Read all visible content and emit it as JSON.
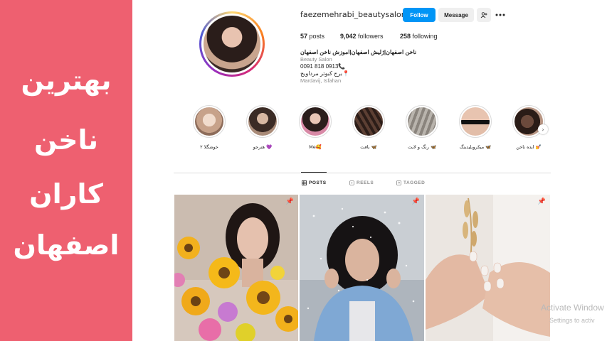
{
  "banner": {
    "lines": [
      "بهترین",
      "ناخن",
      "کاران",
      "اصفهان"
    ],
    "color": "#ee6070"
  },
  "profile": {
    "username": "faezemehrabi_beautysalon",
    "follow_label": "Follow",
    "message_label": "Message",
    "add_user_icon": "add-user-icon",
    "more_icon": "more-icon",
    "stats": {
      "posts_count": "57",
      "posts_label": "posts",
      "followers_count": "9,042",
      "followers_label": "followers",
      "following_count": "258",
      "following_label": "following"
    },
    "bio": {
      "name": "ناخن اصفهان|ژلیش اصفهان|اموزش ناخن اصفهان",
      "category": "Beauty Salon",
      "phone": "0091 818 0913📞",
      "address": "برج کبوتر مرداویج📍",
      "location": "Mardavij, Isfahan"
    }
  },
  "highlights": [
    {
      "label": "ایده ناخن 💅"
    },
    {
      "label": "میکروبلیدینگ 🦋"
    },
    {
      "label": "رنگ و لایت 🦋"
    },
    {
      "label": "بافت 🦋"
    },
    {
      "label": "Me🥰"
    },
    {
      "label": "هنرجو 💜"
    },
    {
      "label": "خوشگلا ۲"
    }
  ],
  "tabs": {
    "posts": "POSTS",
    "reels": "REELS",
    "tagged": "TAGGED"
  },
  "watermark": {
    "line1": "Activate Window",
    "line2": "Settings to activ"
  },
  "colors": {
    "follow": "#0095f6",
    "banner": "#ee6070"
  }
}
